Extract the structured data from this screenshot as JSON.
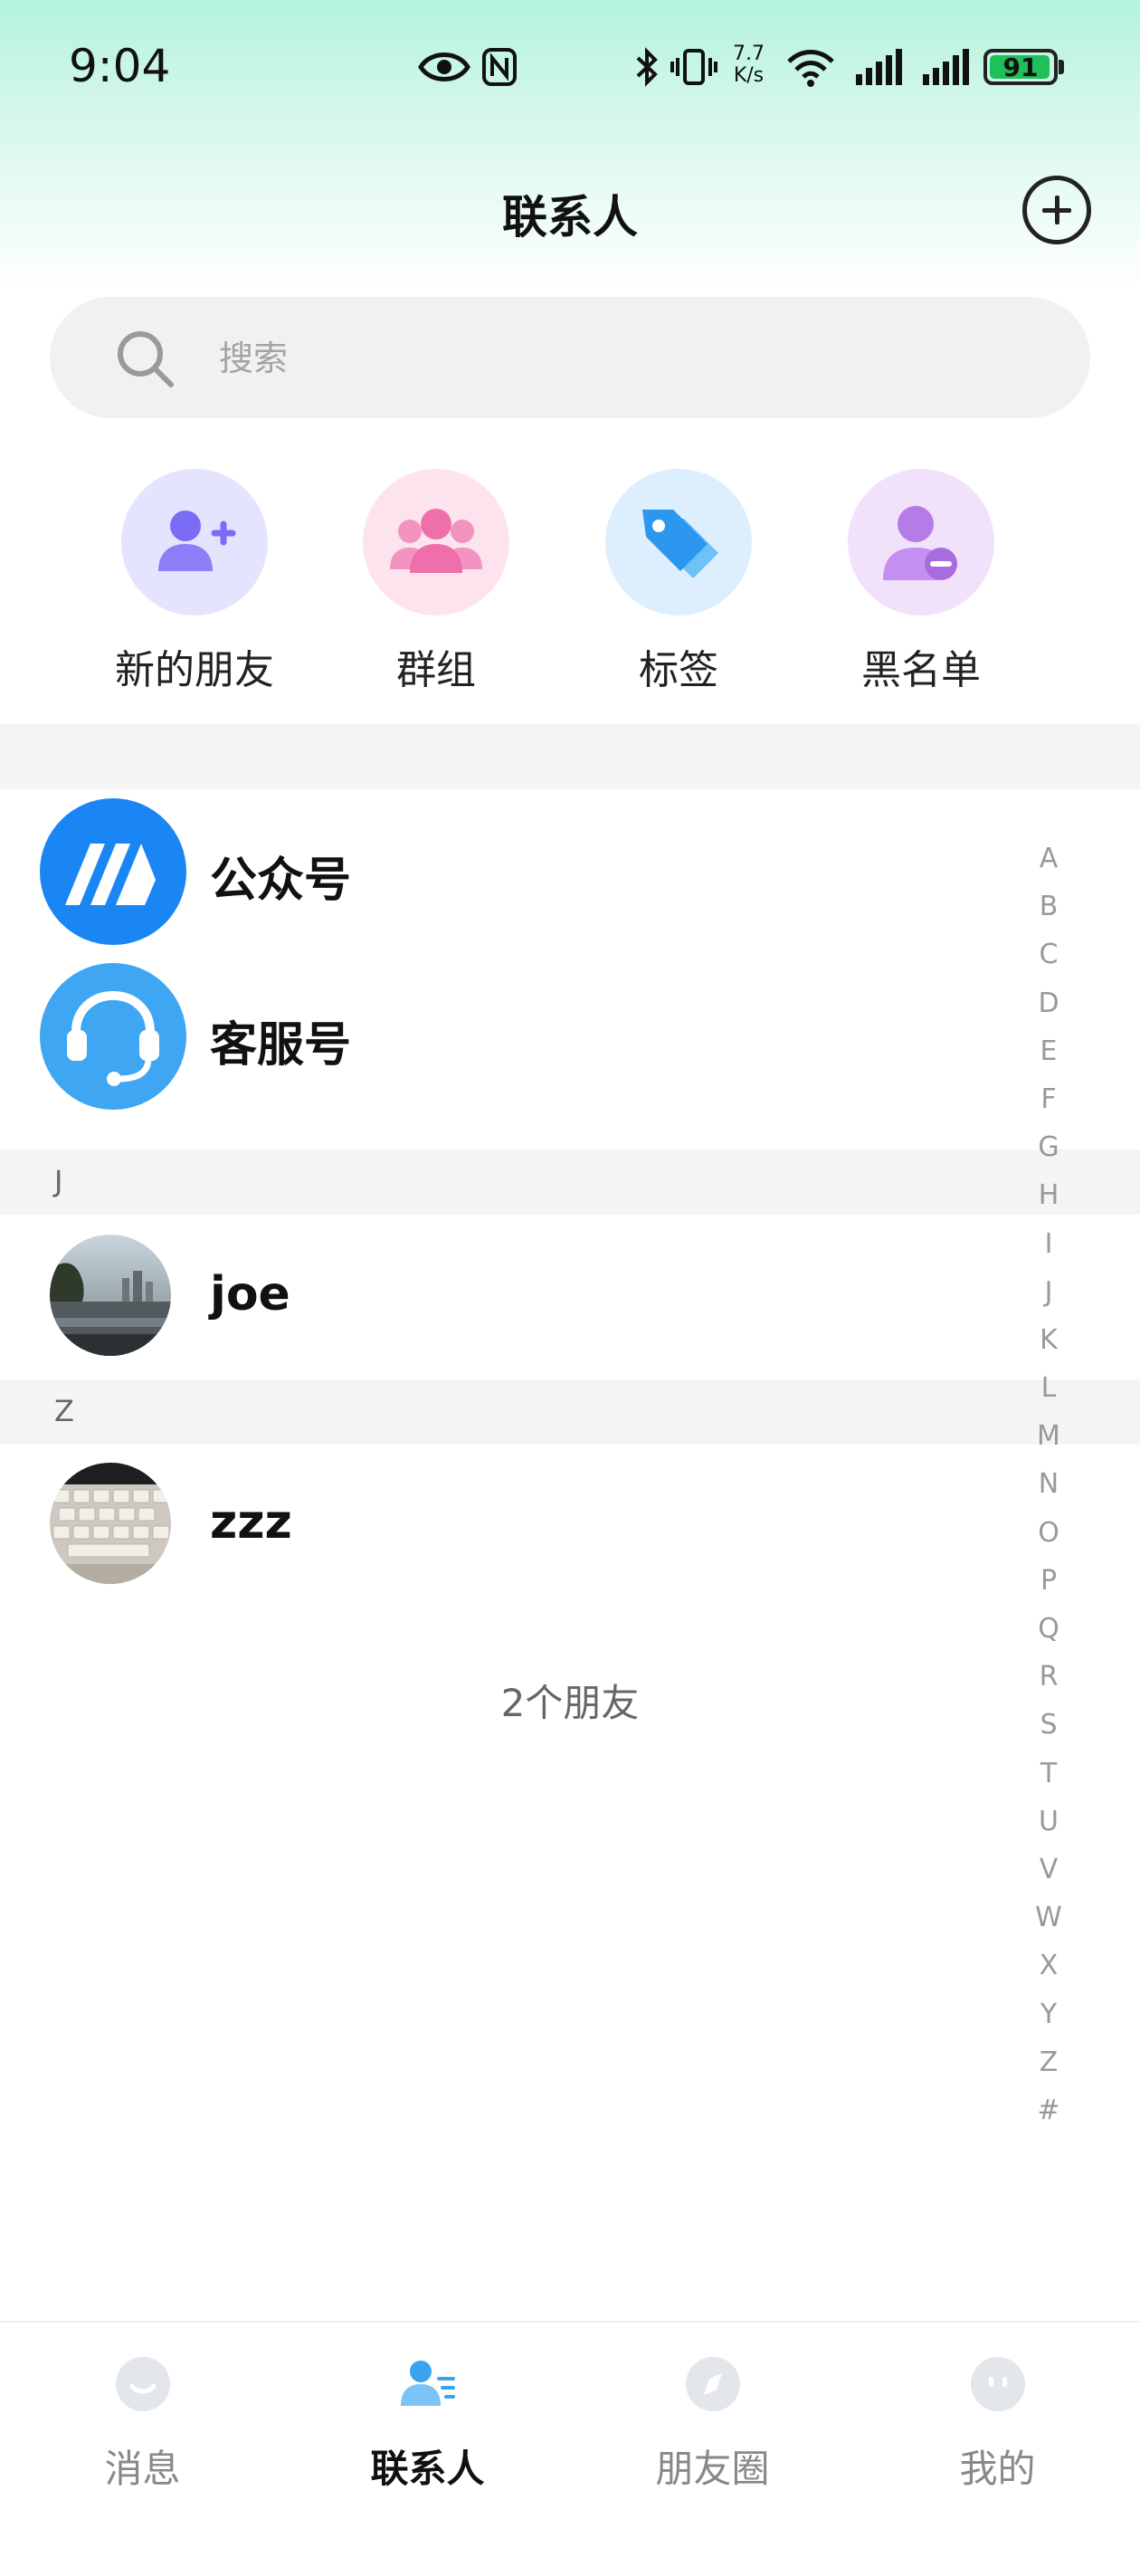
{
  "status_bar": {
    "time": "9:04",
    "net_speed_value": "7.7",
    "net_speed_unit": "K/s",
    "battery_level": "91"
  },
  "header": {
    "title": "联系人"
  },
  "search": {
    "placeholder": "搜索"
  },
  "quick_entries": [
    {
      "label": "新的朋友",
      "icon": "add-friend-icon",
      "bg": "#e4e4ff",
      "color": "#7a6cf4"
    },
    {
      "label": "群组",
      "icon": "group-icon",
      "bg": "#fde3ee",
      "color": "#f07bb2"
    },
    {
      "label": "标签",
      "icon": "tag-icon",
      "bg": "#ddefff",
      "color": "#2b97ee"
    },
    {
      "label": "黑名单",
      "icon": "blacklist-icon",
      "bg": "#f1e1fb",
      "color": "#b57be6"
    }
  ],
  "official": [
    {
      "name": "公众号",
      "icon": "official-account-icon",
      "color": "#1a86f4"
    },
    {
      "name": "客服号",
      "icon": "customer-service-icon",
      "color": "#3ea6f3"
    }
  ],
  "sections": [
    {
      "letter": "J",
      "contacts": [
        {
          "name": "joe"
        }
      ]
    },
    {
      "letter": "Z",
      "contacts": [
        {
          "name": "zzz"
        }
      ]
    }
  ],
  "friend_count": "2个朋友",
  "alphabet": [
    "A",
    "B",
    "C",
    "D",
    "E",
    "F",
    "G",
    "H",
    "I",
    "J",
    "K",
    "L",
    "M",
    "N",
    "O",
    "P",
    "Q",
    "R",
    "S",
    "T",
    "U",
    "V",
    "W",
    "X",
    "Y",
    "Z",
    "#"
  ],
  "bottom_nav": [
    {
      "label": "消息",
      "icon": "message-icon",
      "active": false
    },
    {
      "label": "联系人",
      "icon": "contacts-icon",
      "active": true
    },
    {
      "label": "朋友圈",
      "icon": "moments-icon",
      "active": false
    },
    {
      "label": "我的",
      "icon": "profile-icon",
      "active": false
    }
  ]
}
